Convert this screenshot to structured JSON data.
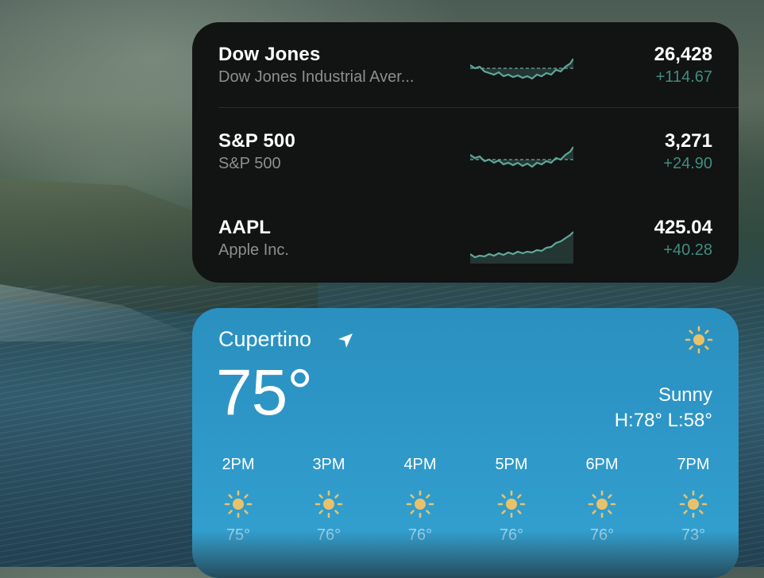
{
  "stocks": {
    "rows": [
      {
        "symbol": "Dow Jones",
        "name": "Dow Jones Industrial Aver...",
        "price": "26,428",
        "change": "+114.67"
      },
      {
        "symbol": "S&P 500",
        "name": "S&P 500",
        "price": "3,271",
        "change": "+24.90"
      },
      {
        "symbol": "AAPL",
        "name": "Apple Inc.",
        "price": "425.04",
        "change": "+40.28"
      }
    ],
    "accent_color": "#3e8e7e"
  },
  "weather": {
    "city": "Cupertino",
    "location_icon": "location-arrow-icon",
    "temperature": "75°",
    "condition": "Sunny",
    "condition_icon": "sun-icon",
    "high_low": "H:78° L:58°",
    "hourly": [
      {
        "time": "2PM",
        "icon": "sun-icon",
        "temp": "75°"
      },
      {
        "time": "3PM",
        "icon": "sun-icon",
        "temp": "76°"
      },
      {
        "time": "4PM",
        "icon": "sun-icon",
        "temp": "76°"
      },
      {
        "time": "5PM",
        "icon": "sun-icon",
        "temp": "76°"
      },
      {
        "time": "6PM",
        "icon": "sun-icon",
        "temp": "76°"
      },
      {
        "time": "7PM",
        "icon": "sun-icon",
        "temp": "73°"
      }
    ],
    "sun_color": "#e8c26a"
  }
}
